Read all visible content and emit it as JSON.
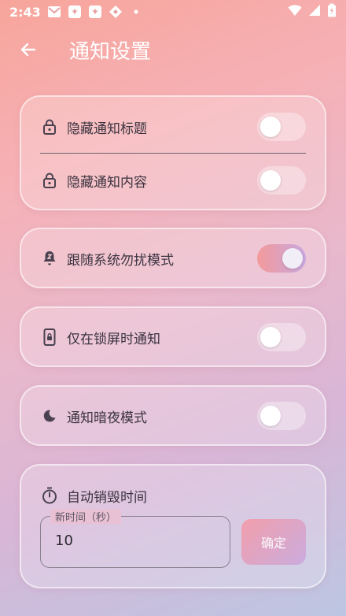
{
  "status_bar": {
    "time": "2:43",
    "left_icons": [
      "mail-icon",
      "bird-app-icon",
      "bird-app-icon-2",
      "diamond-app-icon",
      "dot-icon"
    ],
    "right_icons": [
      "wifi-icon",
      "signal-icon",
      "battery-icon"
    ]
  },
  "header": {
    "title": "通知设置"
  },
  "settings": {
    "hide_title": {
      "label": "隐藏通知标题",
      "enabled": false
    },
    "hide_content": {
      "label": "隐藏通知内容",
      "enabled": false
    },
    "follow_dnd": {
      "label": "跟随系统勿扰模式",
      "enabled": true
    },
    "lock_screen_only": {
      "label": "仅在锁屏时通知",
      "enabled": false
    },
    "night_mode": {
      "label": "通知暗夜模式",
      "enabled": false
    }
  },
  "auto_destroy": {
    "label": "自动销毁时间",
    "field_label": "新时间（秒）",
    "field_value": "10",
    "confirm_label": "确定"
  },
  "colors": {
    "accent_start": "#f39a9a",
    "accent_end": "#c9a8e0"
  }
}
